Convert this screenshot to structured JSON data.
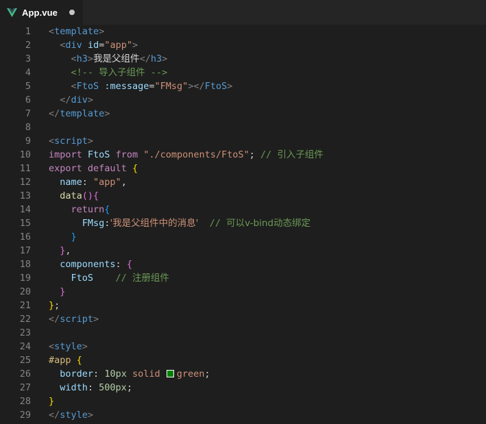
{
  "tab": {
    "title": "App.vue",
    "icon": "vue-logo-icon",
    "modified_indicator": "unsaved-dot-icon"
  },
  "colors": {
    "background": "#1e1e1e",
    "tabbar": "#252526",
    "line_number": "#858585",
    "tag_bracket": "#808080",
    "tag_name": "#569cd6",
    "attr_name": "#9cdcfe",
    "string": "#ce9178",
    "comment": "#6a9955",
    "keyword": "#c586c0",
    "function": "#dcdcaa",
    "number": "#b5cea8",
    "css_selector": "#d7ba7d",
    "brace_yellow": "#ffd700",
    "brace_purple": "#da70d6",
    "brace_blue": "#179fff",
    "plain": "#d4d4d4",
    "green_swatch": "#008000"
  },
  "lines": [
    {
      "n": "1",
      "tokens": [
        {
          "t": "<",
          "c": "tag_bracket"
        },
        {
          "t": "template",
          "c": "tag_name"
        },
        {
          "t": ">",
          "c": "tag_bracket"
        }
      ]
    },
    {
      "n": "2",
      "tokens": [
        {
          "t": "  ",
          "c": "plain"
        },
        {
          "t": "<",
          "c": "tag_bracket"
        },
        {
          "t": "div",
          "c": "tag_name"
        },
        {
          "t": " ",
          "c": "plain"
        },
        {
          "t": "id",
          "c": "attr_name"
        },
        {
          "t": "=",
          "c": "plain"
        },
        {
          "t": "\"app\"",
          "c": "string"
        },
        {
          "t": ">",
          "c": "tag_bracket"
        }
      ]
    },
    {
      "n": "3",
      "tokens": [
        {
          "t": "    ",
          "c": "plain"
        },
        {
          "t": "<",
          "c": "tag_bracket"
        },
        {
          "t": "h3",
          "c": "tag_name"
        },
        {
          "t": ">",
          "c": "tag_bracket"
        },
        {
          "t": "我是父组件",
          "c": "plain",
          "cjk": true
        },
        {
          "t": "</",
          "c": "tag_bracket"
        },
        {
          "t": "h3",
          "c": "tag_name"
        },
        {
          "t": ">",
          "c": "tag_bracket"
        }
      ]
    },
    {
      "n": "4",
      "tokens": [
        {
          "t": "    ",
          "c": "plain"
        },
        {
          "t": "<!-- ",
          "c": "comment"
        },
        {
          "t": "导入子组件",
          "c": "comment",
          "cjk": true
        },
        {
          "t": " -->",
          "c": "comment"
        }
      ]
    },
    {
      "n": "5",
      "tokens": [
        {
          "t": "    ",
          "c": "plain"
        },
        {
          "t": "<",
          "c": "tag_bracket"
        },
        {
          "t": "FtoS",
          "c": "tag_name"
        },
        {
          "t": " ",
          "c": "plain"
        },
        {
          "t": ":message",
          "c": "attr_name"
        },
        {
          "t": "=",
          "c": "plain"
        },
        {
          "t": "\"FMsg\"",
          "c": "string"
        },
        {
          "t": "></",
          "c": "tag_bracket"
        },
        {
          "t": "FtoS",
          "c": "tag_name"
        },
        {
          "t": ">",
          "c": "tag_bracket"
        }
      ]
    },
    {
      "n": "6",
      "tokens": [
        {
          "t": "  ",
          "c": "plain"
        },
        {
          "t": "</",
          "c": "tag_bracket"
        },
        {
          "t": "div",
          "c": "tag_name"
        },
        {
          "t": ">",
          "c": "tag_bracket"
        }
      ]
    },
    {
      "n": "7",
      "tokens": [
        {
          "t": "</",
          "c": "tag_bracket"
        },
        {
          "t": "template",
          "c": "tag_name"
        },
        {
          "t": ">",
          "c": "tag_bracket"
        }
      ]
    },
    {
      "n": "8",
      "tokens": []
    },
    {
      "n": "9",
      "tokens": [
        {
          "t": "<",
          "c": "tag_bracket"
        },
        {
          "t": "script",
          "c": "tag_name"
        },
        {
          "t": ">",
          "c": "tag_bracket"
        }
      ]
    },
    {
      "n": "10",
      "tokens": [
        {
          "t": "import",
          "c": "keyword"
        },
        {
          "t": " FtoS ",
          "c": "attr_name"
        },
        {
          "t": "from",
          "c": "keyword"
        },
        {
          "t": " ",
          "c": "plain"
        },
        {
          "t": "\"./components/FtoS\"",
          "c": "string"
        },
        {
          "t": "; ",
          "c": "plain"
        },
        {
          "t": "// ",
          "c": "comment"
        },
        {
          "t": "引入子组件",
          "c": "comment",
          "cjk": true
        }
      ]
    },
    {
      "n": "11",
      "tokens": [
        {
          "t": "export",
          "c": "keyword"
        },
        {
          "t": " ",
          "c": "plain"
        },
        {
          "t": "default",
          "c": "keyword"
        },
        {
          "t": " ",
          "c": "plain"
        },
        {
          "t": "{",
          "c": "brace_yellow"
        }
      ]
    },
    {
      "n": "12",
      "tokens": [
        {
          "t": "  ",
          "c": "plain"
        },
        {
          "t": "name",
          "c": "attr_name"
        },
        {
          "t": ": ",
          "c": "plain"
        },
        {
          "t": "\"app\"",
          "c": "string"
        },
        {
          "t": ",",
          "c": "plain"
        }
      ]
    },
    {
      "n": "13",
      "tokens": [
        {
          "t": "  ",
          "c": "plain"
        },
        {
          "t": "data",
          "c": "function"
        },
        {
          "t": "()",
          "c": "brace_purple"
        },
        {
          "t": "{",
          "c": "brace_purple"
        }
      ]
    },
    {
      "n": "14",
      "tokens": [
        {
          "t": "    ",
          "c": "plain"
        },
        {
          "t": "return",
          "c": "keyword"
        },
        {
          "t": "{",
          "c": "brace_blue"
        }
      ]
    },
    {
      "n": "15",
      "tokens": [
        {
          "t": "      ",
          "c": "plain"
        },
        {
          "t": "FMsg",
          "c": "attr_name"
        },
        {
          "t": ":",
          "c": "plain"
        },
        {
          "t": "'我是父组件中的消息'",
          "c": "string",
          "cjk": true
        },
        {
          "t": "  ",
          "c": "plain"
        },
        {
          "t": "// ",
          "c": "comment"
        },
        {
          "t": "可以v-bind动态绑定",
          "c": "comment",
          "cjk": true
        }
      ]
    },
    {
      "n": "16",
      "tokens": [
        {
          "t": "    ",
          "c": "plain"
        },
        {
          "t": "}",
          "c": "brace_blue"
        }
      ]
    },
    {
      "n": "17",
      "tokens": [
        {
          "t": "  ",
          "c": "plain"
        },
        {
          "t": "}",
          "c": "brace_purple"
        },
        {
          "t": ",",
          "c": "plain"
        }
      ]
    },
    {
      "n": "18",
      "tokens": [
        {
          "t": "  ",
          "c": "plain"
        },
        {
          "t": "components",
          "c": "attr_name"
        },
        {
          "t": ": ",
          "c": "plain"
        },
        {
          "t": "{",
          "c": "brace_purple"
        }
      ]
    },
    {
      "n": "19",
      "tokens": [
        {
          "t": "    ",
          "c": "plain"
        },
        {
          "t": "FtoS",
          "c": "attr_name"
        },
        {
          "t": "    ",
          "c": "plain"
        },
        {
          "t": "// ",
          "c": "comment"
        },
        {
          "t": "注册组件",
          "c": "comment",
          "cjk": true
        }
      ]
    },
    {
      "n": "20",
      "tokens": [
        {
          "t": "  ",
          "c": "plain"
        },
        {
          "t": "}",
          "c": "brace_purple"
        }
      ]
    },
    {
      "n": "21",
      "tokens": [
        {
          "t": "}",
          "c": "brace_yellow"
        },
        {
          "t": ";",
          "c": "plain"
        }
      ]
    },
    {
      "n": "22",
      "tokens": [
        {
          "t": "</",
          "c": "tag_bracket"
        },
        {
          "t": "script",
          "c": "tag_name"
        },
        {
          "t": ">",
          "c": "tag_bracket"
        }
      ]
    },
    {
      "n": "23",
      "tokens": []
    },
    {
      "n": "24",
      "tokens": [
        {
          "t": "<",
          "c": "tag_bracket"
        },
        {
          "t": "style",
          "c": "tag_name"
        },
        {
          "t": ">",
          "c": "tag_bracket"
        }
      ]
    },
    {
      "n": "25",
      "tokens": [
        {
          "t": "#app",
          "c": "css_selector"
        },
        {
          "t": " ",
          "c": "plain"
        },
        {
          "t": "{",
          "c": "brace_yellow"
        }
      ]
    },
    {
      "n": "26",
      "tokens": [
        {
          "t": "  ",
          "c": "plain"
        },
        {
          "t": "border",
          "c": "attr_name"
        },
        {
          "t": ": ",
          "c": "plain"
        },
        {
          "t": "10px",
          "c": "number"
        },
        {
          "t": " solid ",
          "c": "string"
        },
        {
          "t": "",
          "c": "plain",
          "swatch": true
        },
        {
          "t": "green",
          "c": "string"
        },
        {
          "t": ";",
          "c": "plain"
        }
      ]
    },
    {
      "n": "27",
      "tokens": [
        {
          "t": "  ",
          "c": "plain"
        },
        {
          "t": "width",
          "c": "attr_name"
        },
        {
          "t": ": ",
          "c": "plain"
        },
        {
          "t": "500px",
          "c": "number"
        },
        {
          "t": ";",
          "c": "plain"
        }
      ]
    },
    {
      "n": "28",
      "tokens": [
        {
          "t": "}",
          "c": "brace_yellow"
        }
      ]
    },
    {
      "n": "29",
      "tokens": [
        {
          "t": "</",
          "c": "tag_bracket"
        },
        {
          "t": "style",
          "c": "tag_name"
        },
        {
          "t": ">",
          "c": "tag_bracket"
        }
      ]
    }
  ]
}
